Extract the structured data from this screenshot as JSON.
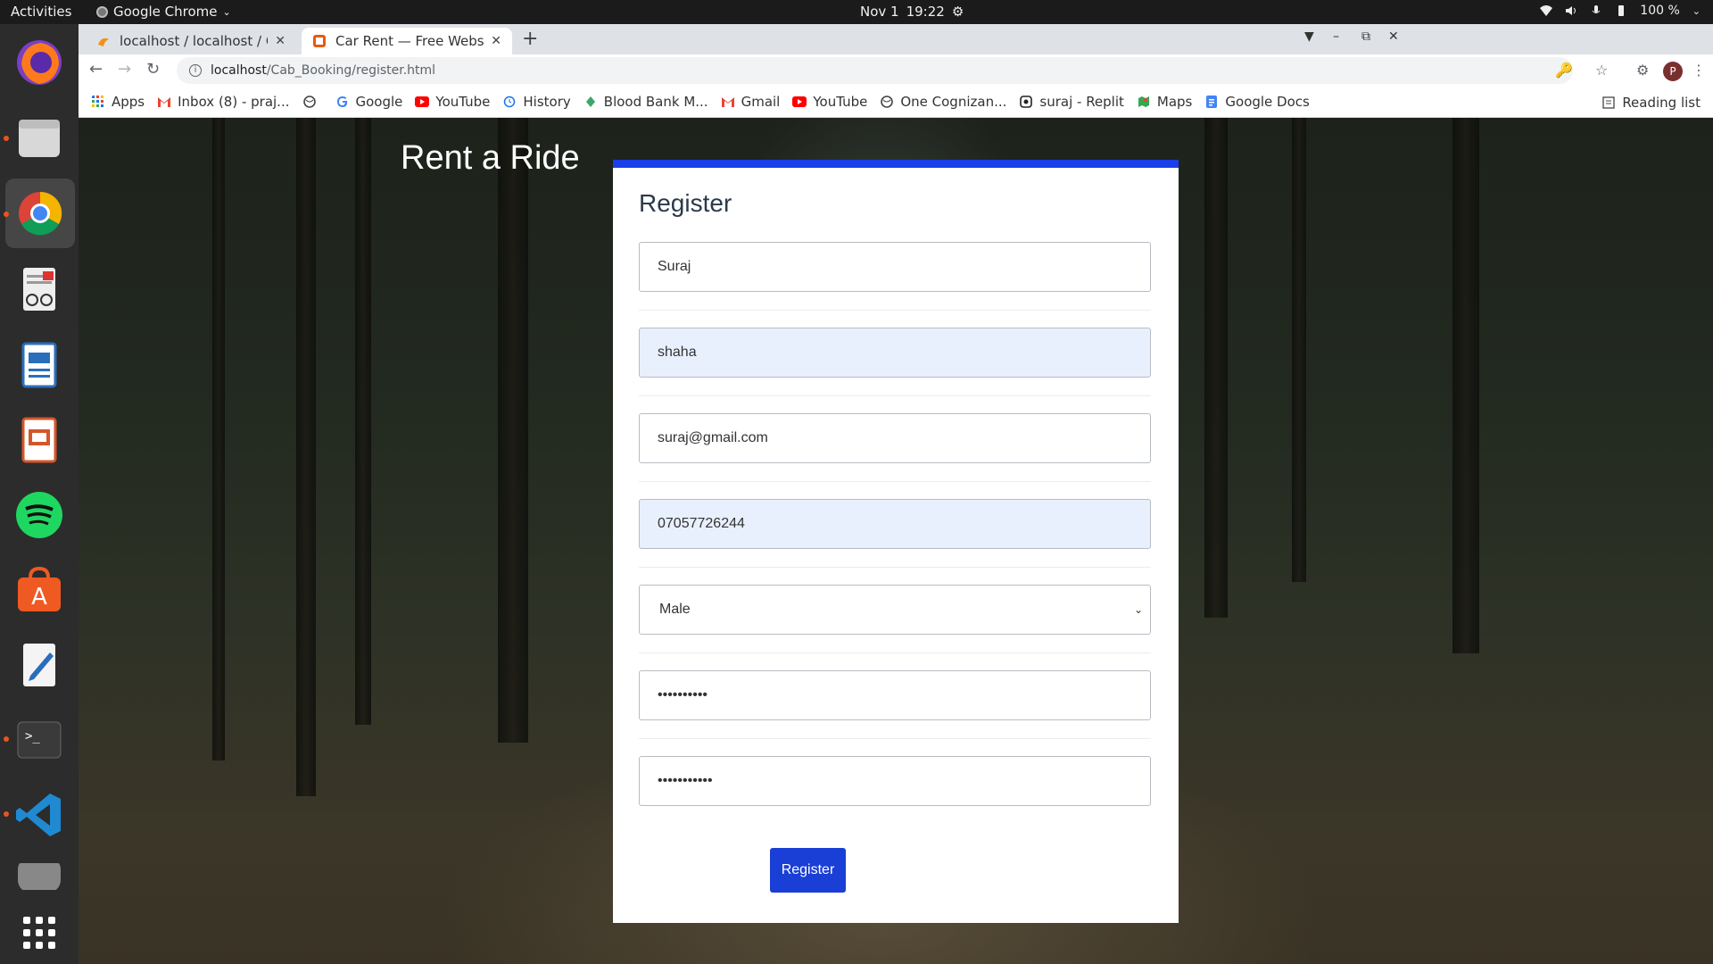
{
  "topbar": {
    "activities": "Activities",
    "app_name": "Google Chrome",
    "date": "Nov 1",
    "time": "19:22",
    "battery": "100 %"
  },
  "dock": {
    "apps": [
      "firefox-icon",
      "files-icon",
      "chrome-icon",
      "document-viewer-icon",
      "libreoffice-writer-icon",
      "libreoffice-impress-icon",
      "spotify-icon",
      "ubuntu-software-icon",
      "text-editor-icon",
      "terminal-icon",
      "vscode-icon",
      "disk-icon",
      "show-apps-icon"
    ]
  },
  "browser": {
    "tabs": [
      {
        "title": "localhost / localhost / Cab",
        "active": false
      },
      {
        "title": "Car Rent — Free Website",
        "active": true
      }
    ],
    "url_host": "localhost",
    "url_path": "/Cab_Booking/register.html",
    "bookmarks": [
      {
        "label": "Apps",
        "icon": "apps-grid-icon"
      },
      {
        "label": "Inbox (8) - praj...",
        "icon": "gmail-icon"
      },
      {
        "label": "",
        "icon": "globe-icon"
      },
      {
        "label": "Google",
        "icon": "google-icon"
      },
      {
        "label": "YouTube",
        "icon": "youtube-icon"
      },
      {
        "label": "History",
        "icon": "history-icon"
      },
      {
        "label": "Blood Bank M...",
        "icon": "blood-bank-icon"
      },
      {
        "label": "Gmail",
        "icon": "gmail-icon"
      },
      {
        "label": "YouTube",
        "icon": "youtube-icon"
      },
      {
        "label": "One Cognizan...",
        "icon": "globe-icon"
      },
      {
        "label": "suraj - Replit",
        "icon": "replit-icon"
      },
      {
        "label": "Maps",
        "icon": "maps-icon"
      },
      {
        "label": "Google Docs",
        "icon": "docs-icon"
      }
    ],
    "reading_list": "Reading list"
  },
  "page": {
    "brand": "Rent a Ride",
    "form_title": "Register",
    "fields": {
      "first_name": "Suraj",
      "last_name": "shaha",
      "email": "suraj@gmail.com",
      "phone": "07057726244",
      "gender": "Male",
      "password": "••••••••••",
      "confirm_password": "•••••••••••"
    },
    "submit_label": "Register"
  },
  "colors": {
    "accent": "#1a3ee8",
    "button": "#1a3fd6",
    "autofill": "#e8f0fe"
  }
}
